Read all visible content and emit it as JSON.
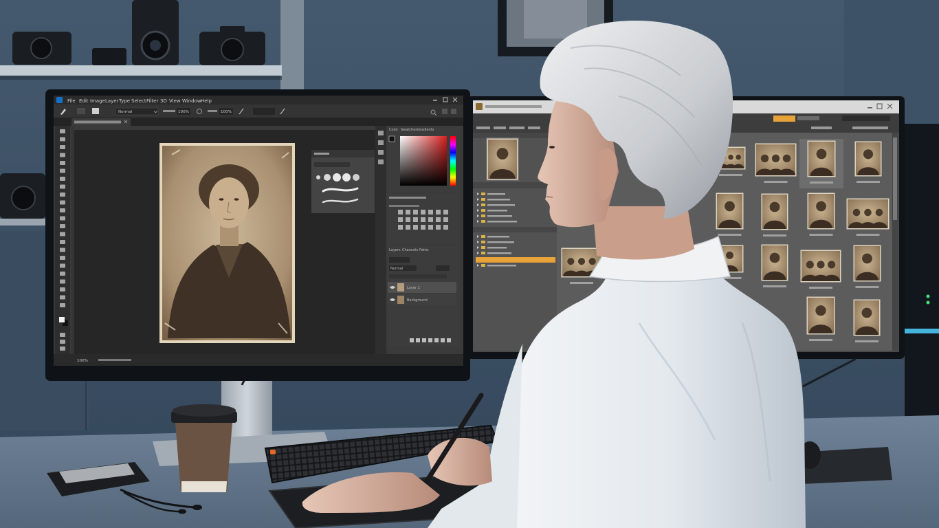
{
  "photoshop": {
    "menu": [
      "File",
      "Edit",
      "Image",
      "Layer",
      "Type",
      "Select",
      "Filter",
      "3D",
      "View",
      "Window",
      "Help"
    ],
    "options": {
      "mode": "Normal",
      "opacity": "100%",
      "flow": "100%"
    },
    "color_tabs": [
      "Color",
      "Swatches",
      "Gradients"
    ],
    "layers_tabs": [
      "Layers",
      "Channels",
      "Paths"
    ],
    "blend_mode": "Normal",
    "layers": [
      "Layer 1",
      "Background"
    ],
    "zoom": "100%"
  },
  "icons": {
    "photoshop_app": "photoshop-app-icon",
    "bridge_app": "bridge-app-icon",
    "brush_tool": "brush-tool-icon",
    "layer_visibility": "eye-icon"
  },
  "colors": {
    "wall": "#3b4e62",
    "desk": "#62758a",
    "ui_dark": "#2c2c2c",
    "bridge_highlight": "#e8a23a",
    "pc_glow": "#4fd0ff",
    "shirt": "#e9edf1",
    "hair": "#d6d8da"
  }
}
